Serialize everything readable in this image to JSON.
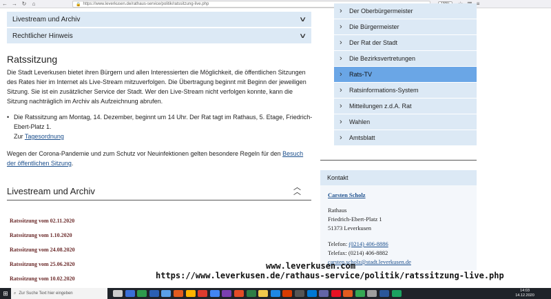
{
  "browser": {
    "url": "https://www.leverkusen.de/rathaus-service/politik/ratssitzung-live.php",
    "zoom": "130%"
  },
  "accordions": [
    {
      "label": "Livestream und Archiv"
    },
    {
      "label": "Rechtlicher Hinweis"
    }
  ],
  "main": {
    "heading": "Ratssitzung",
    "intro": "Die Stadt Leverkusen bietet ihren Bürgern und allen Interessierten die Möglichkeit, die öffentlichen Sitzungen des Rates hier im Internet als Live-Stream mitzuverfolgen. Die Übertragung beginnt mit Beginn der jeweiligen Sitzung. Sie ist ein zusätzlicher Service der Stadt. Wer den Live-Stream nicht verfolgen konnte, kann die Sitzung nachträglich im Archiv als Aufzeichnung abrufen.",
    "bullet_text": "Die Ratssitzung am Montag, 14. Dezember, beginnt um 14 Uhr. Der Rat tagt im Rathaus, 5. Etage, Friedrich-Ebert-Platz 1.",
    "bullet_zur": "Zur",
    "bullet_link": "Tagesordnung",
    "corona_text": "Wegen der Corona-Pandemie und zum Schutz vor Neuinfektionen gelten besondere Regeln für den",
    "corona_link": "Besuch der öffentlichen Sitzung",
    "corona_end": "."
  },
  "livestream": {
    "heading": "Livestream und Archiv",
    "items": [
      "Ratssitzung vom 02.11.2020",
      "Ratssitzung vom 1.10.2020",
      "Ratssitzung vom 24.08.2020",
      "Ratssitzung vom 25.06.2020",
      "Ratssitzung vom 10.02.2020"
    ]
  },
  "menu": {
    "items": [
      {
        "label": "Der Oberbürgermeister",
        "active": false
      },
      {
        "label": "Die Bürgermeister",
        "active": false
      },
      {
        "label": "Der Rat der Stadt",
        "active": false
      },
      {
        "label": "Die Bezirksvertretungen",
        "active": false
      },
      {
        "label": "Rats-TV",
        "active": true
      },
      {
        "label": "Ratsinformations-System",
        "active": false
      },
      {
        "label": "Mitteilungen z.d.A. Rat",
        "active": false
      },
      {
        "label": "Wahlen",
        "active": false
      },
      {
        "label": "Amtsblatt",
        "active": false
      }
    ]
  },
  "kontakt": {
    "heading": "Kontakt",
    "name": "Carsten Scholz",
    "address_1": "Rathaus",
    "address_2": "Friedrich-Ebert-Platz 1",
    "address_3": "51373 Leverkusen",
    "phone_label": "Telefon:",
    "phone": "(0214) 406-8886",
    "fax": "Telefax: (0214) 406-8882",
    "email": "carsten.scholz@stadt.leverkusen.de"
  },
  "caption": {
    "line1": "www.leverkusen.com",
    "line2": "https://www.leverkusen.de/rathaus-service/politik/ratssitzung-live.php"
  },
  "taskbar": {
    "search_placeholder": "Zur Suche Text hier eingeben",
    "time": "14:03",
    "date": "14.12.2020",
    "icon_colors": [
      "#cccccc",
      "#3a6fd8",
      "#2e9a4c",
      "#2b5fb3",
      "#5aa0e8",
      "#e25b1f",
      "#ffb400",
      "#dd3b2e",
      "#4285f4",
      "#7a3fb0",
      "#e34c26",
      "#2d7d46",
      "#f2c94c",
      "#1e88e5",
      "#d83b01",
      "#555555",
      "#0078d4",
      "#6264a7",
      "#e81123",
      "#e25b1f",
      "#34a853",
      "#9e9e9e",
      "#2b579a",
      "#1aa260"
    ]
  }
}
